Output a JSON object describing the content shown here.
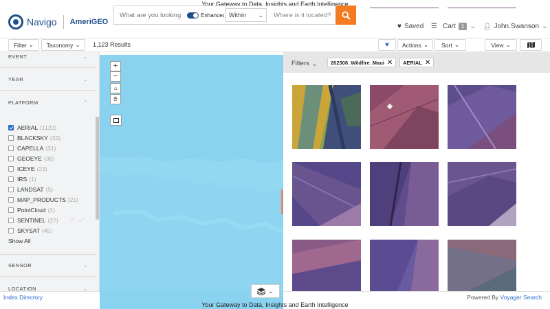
{
  "banner": {
    "text": "Your Gateway to Data, Insights and Earth Intelligence"
  },
  "header": {
    "logo_text": "Navigo",
    "partner_logo": "AmeriGEO",
    "search_placeholder": "What are you looking",
    "enhanced_label": "Enhanced",
    "within_value": "Within",
    "where_placeholder": "Where is it located?",
    "saved_label": "Saved",
    "cart_label": "Cart",
    "cart_count": "1",
    "user_name": "John.Swanson"
  },
  "toolbar": {
    "filter_label": "Filter",
    "taxonomy_label": "Taxonomy",
    "results_count": "1,123 Results",
    "actions_label": "Actions",
    "sort_label": "Sort",
    "view_label": "View"
  },
  "sidebar": {
    "sections": [
      "EVENT",
      "YEAR",
      "PLATFORM",
      "SENSOR",
      "LOCATION"
    ],
    "platform_items": [
      {
        "label": "AERIAL",
        "count": "(1123)",
        "checked": true
      },
      {
        "label": "BLACKSKY",
        "count": "(32)",
        "checked": false
      },
      {
        "label": "CAPELLA",
        "count": "(31)",
        "checked": false
      },
      {
        "label": "GEOEYE",
        "count": "(38)",
        "checked": false
      },
      {
        "label": "ICEYE",
        "count": "(23)",
        "checked": false
      },
      {
        "label": "IRS",
        "count": "(1)",
        "checked": false
      },
      {
        "label": "LANDSAT",
        "count": "(5)",
        "checked": false
      },
      {
        "label": "MAP_PRODUCTS",
        "count": "(21)",
        "checked": false
      },
      {
        "label": "PointCloud",
        "count": "(1)",
        "checked": false
      },
      {
        "label": "SENTINEL",
        "count": "(27)",
        "checked": false
      },
      {
        "label": "SKYSAT",
        "count": "(45)",
        "checked": false
      }
    ],
    "show_all": "Show All"
  },
  "map": {
    "zoom_in": "+",
    "zoom_out": "−"
  },
  "results": {
    "filters_label": "Filters",
    "chips": [
      "202308_Wildfire_Maui",
      "AERIAL"
    ]
  },
  "footer": {
    "index_link": "Index Directory",
    "tagline": "Your Gateway to Data, Insights and Earth Intelligence",
    "powered_by": "Powered By",
    "powered_name": "Voyager Search"
  },
  "colors": {
    "brand": "#1e4f8a",
    "accent": "#f47b20",
    "link": "#2d6ec9",
    "map_water": "#89d3f0"
  }
}
